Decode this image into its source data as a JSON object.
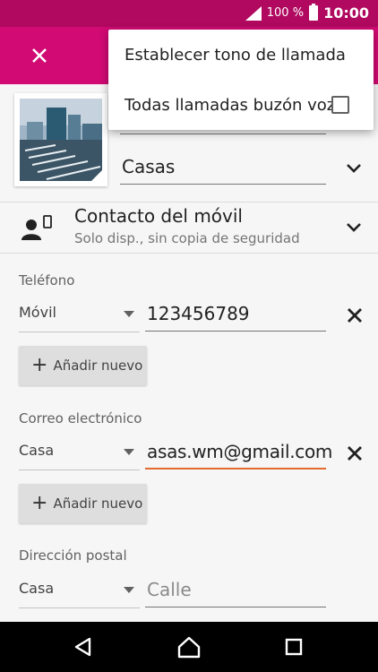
{
  "status_bar": {
    "battery": "100 %",
    "time": "10:00"
  },
  "header": {
    "close_icon": "close-icon"
  },
  "contact": {
    "hidden_field_value": "",
    "last_name": "Casas"
  },
  "account": {
    "title": "Contacto del móvil",
    "subtitle": "Solo disp., sin copia de seguridad"
  },
  "phone": {
    "label": "Teléfono",
    "type": "Móvil",
    "value": "123456789",
    "add_label": "Añadir nuevo"
  },
  "email": {
    "label": "Correo electrónico",
    "type": "Casa",
    "value": "asas.wm@gmail.com",
    "add_label": "Añadir nuevo"
  },
  "address": {
    "label": "Dirección postal",
    "type": "Casa",
    "street_placeholder": "Calle"
  },
  "overflow_menu": {
    "items": [
      {
        "label": "Establecer tono de llamada"
      },
      {
        "label": "Todas llamadas buzón voz",
        "checked": false
      }
    ]
  },
  "colors": {
    "status_bar": "#b0095f",
    "app_bar": "#d10a74",
    "focus_underline": "#e56a2e"
  }
}
